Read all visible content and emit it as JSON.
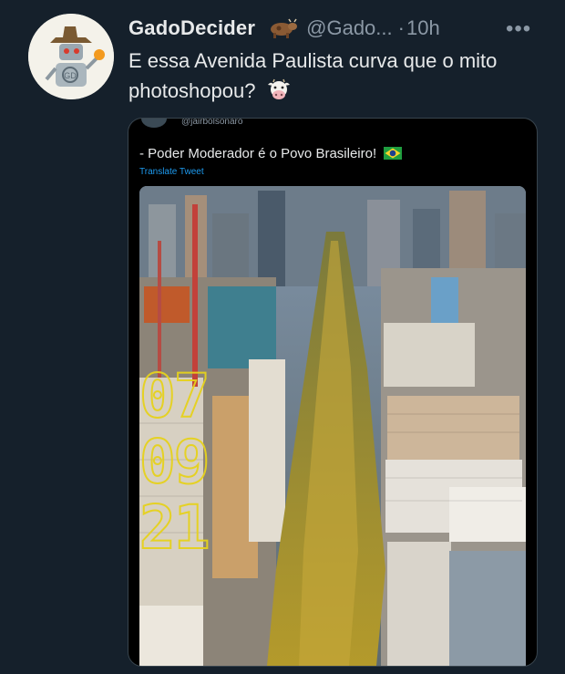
{
  "tweet": {
    "display_name": "GadoDecider",
    "handle": "@Gado...",
    "separator": "·",
    "time": "10h",
    "more": "•••",
    "text": "E essa Avenida Paulista curva que o mito photoshopou?"
  },
  "quoted": {
    "handle": "@jairbolsonaro",
    "text": "- Poder Moderador é o Povo Brasileiro!",
    "translate_label": "Translate Tweet",
    "image_overlay": [
      "07",
      "09",
      "21"
    ]
  },
  "icons": {
    "badge": "cow-emoji",
    "emoji": "cow-face-emoji",
    "flag": "brazil-flag",
    "more": "more-options-icon"
  },
  "colors": {
    "background": "#15202b",
    "primary_text": "#e7e9ea",
    "secondary_text": "#8b98a5",
    "link": "#1d9bf0",
    "overlay_yellow": "#e6d21c"
  }
}
